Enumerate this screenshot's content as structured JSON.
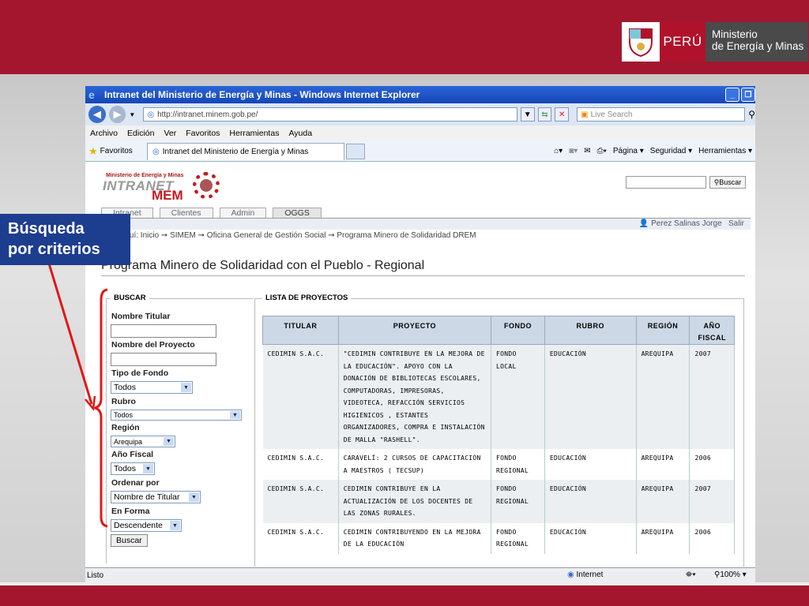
{
  "brand": {
    "peru": "PERÚ",
    "ministry_line1": "Ministerio",
    "ministry_line2": "de Energía y Minas"
  },
  "callout": {
    "line1": "Búsqueda",
    "line2": "por criterios"
  },
  "browser": {
    "title": "Intranet del Ministerio de Energía y Minas - Windows Internet Explorer",
    "url": "http://intranet.minem.gob.pe/",
    "search_placeholder": "Live Search",
    "menu": [
      "Archivo",
      "Edición",
      "Ver",
      "Favoritos",
      "Herramientas",
      "Ayuda"
    ],
    "favorites_label": "Favoritos",
    "tab_title": "Intranet del Ministerio de Energía y Minas",
    "commands": [
      "Página ▾",
      "Seguridad ▾",
      "Herramientas ▾"
    ],
    "status_left": "Listo",
    "status_zone": "Internet",
    "zoom": "100%"
  },
  "site": {
    "logo_small": "Ministerio de Energía y Minas",
    "logo_intranet": "INTRANET",
    "logo_mem": "MEM",
    "search_button": "Buscar",
    "tabs": [
      "Intranet",
      "Clientes",
      "Admin",
      "OGGS"
    ],
    "user": "Perez Salinas Jorge",
    "logout": "Salir",
    "breadcrumb": "Está aquí: Inicio ➞ SIMEM ➞ Oficina General de Gestión Social ➞ Programa Minero de Solidaridad DREM",
    "page_title": "Programa Minero de Solidaridad con el Pueblo - Regional"
  },
  "buscar": {
    "legend": "BUSCAR",
    "nombre_titular": "Nombre Titular",
    "nombre_proyecto": "Nombre del Proyecto",
    "tipo_fondo": "Tipo de Fondo",
    "tipo_fondo_value": "Todos",
    "rubro": "Rubro",
    "rubro_value": "Todos",
    "region": "Región",
    "region_value": "Arequipa",
    "anio_fiscal": "Año Fiscal",
    "anio_value": "Todos",
    "ordenar": "Ordenar por",
    "ordenar_value": "Nombre de Titular",
    "en_forma": "En Forma",
    "en_forma_value": "Descendente",
    "button": "Buscar"
  },
  "lista": {
    "legend": "LISTA DE PROYECTOS",
    "headers": [
      "TITULAR",
      "PROYECTO",
      "FONDO",
      "RUBRO",
      "REGIÓN",
      "AÑO FISCAL"
    ],
    "rows": [
      {
        "titular": "CEDIMIN S.A.C.",
        "proyecto": "\"CEDIMIN CONTRIBUYE EN LA MEJORA DE LA EDUCACIÓN\". APOYO CON LA DONACIÓN DE BIBLIOTECAS ESCOLARES, COMPUTADORAS, IMPRESORAS, VIDEOTECA, REFACCIÓN SERVICIOS HIGIENICOS , ESTANTES ORGANIZADORES, COMPRA E INSTALACIÓN DE MALLA \"RASHELL\".",
        "fondo": "FONDO LOCAL",
        "rubro": "EDUCACIÓN",
        "region": "AREQUIPA",
        "anio": "2007"
      },
      {
        "titular": "CEDIMIN S.A.C.",
        "proyecto": "CARAVELÍ: 2 CURSOS DE CAPACITACIÓN A MAESTROS ( TECSUP)",
        "fondo": "FONDO REGIONAL",
        "rubro": "EDUCACIÓN",
        "region": "AREQUIPA",
        "anio": "2006"
      },
      {
        "titular": "CEDIMIN S.A.C.",
        "proyecto": "CEDIMIN CONTRIBUYE EN LA ACTUALIZACIÓN DE LOS DOCENTES DE LAS ZONAS RURALES.",
        "fondo": "FONDO REGIONAL",
        "rubro": "EDUCACIÓN",
        "region": "AREQUIPA",
        "anio": "2007"
      },
      {
        "titular": "CEDIMIN S.A.C.",
        "proyecto": "CEDIMIN CONTRIBUYENDO EN LA MEJORA DE LA EDUCACIÓN",
        "fondo": "FONDO REGIONAL",
        "rubro": "EDUCACIÓN",
        "region": "AREQUIPA",
        "anio": "2006"
      }
    ]
  }
}
